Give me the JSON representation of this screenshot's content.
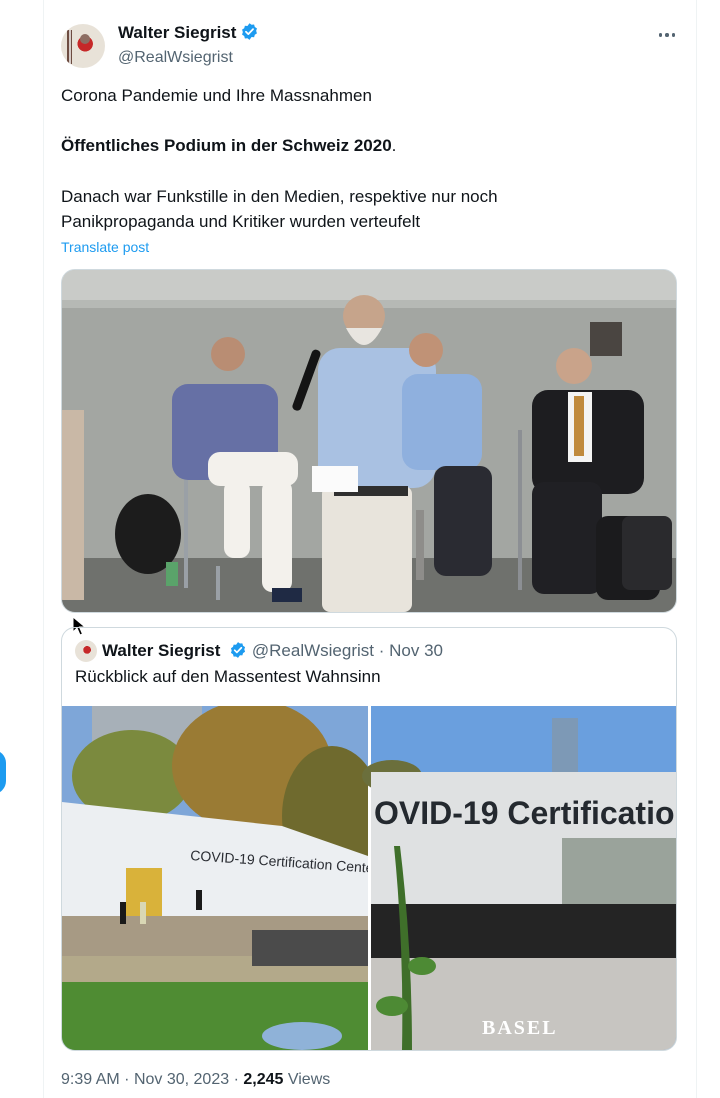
{
  "author": {
    "display_name": "Walter Siegrist",
    "handle": "@RealWsiegrist",
    "verified_icon": "verified-badge-icon",
    "more_icon": "more-options-icon"
  },
  "post": {
    "line1": "Corona Pandemie und Ihre Massnahmen",
    "line2_bold": "Öffentliches Podium in der Schweiz 2020",
    "line2_tail": ".",
    "line3a": "Danach war Funkstille in den Medien, respektive nur noch",
    "line3b": "Panikpropaganda und Kritiker wurden verteufelt",
    "translate": "Translate post"
  },
  "quote": {
    "display_name": "Walter Siegrist",
    "handle": "@RealWsiegrist",
    "separator": "·",
    "date": "Nov 30",
    "text": "Rückblick auf den Massentest Wahnsinn",
    "image_left_sign": "COVID-19 Certification Center",
    "image_right_sign": "OVID-19 Certification",
    "image_right_caption": "BASEL"
  },
  "footer": {
    "time": "9:39 AM",
    "separator": "·",
    "date": "Nov 30, 2023",
    "views_count": "2,245",
    "views_label": "Views"
  },
  "colors": {
    "accent": "#1d9bf0",
    "text_primary": "#0f1419",
    "text_secondary": "#536471",
    "border": "#cfd9de"
  }
}
